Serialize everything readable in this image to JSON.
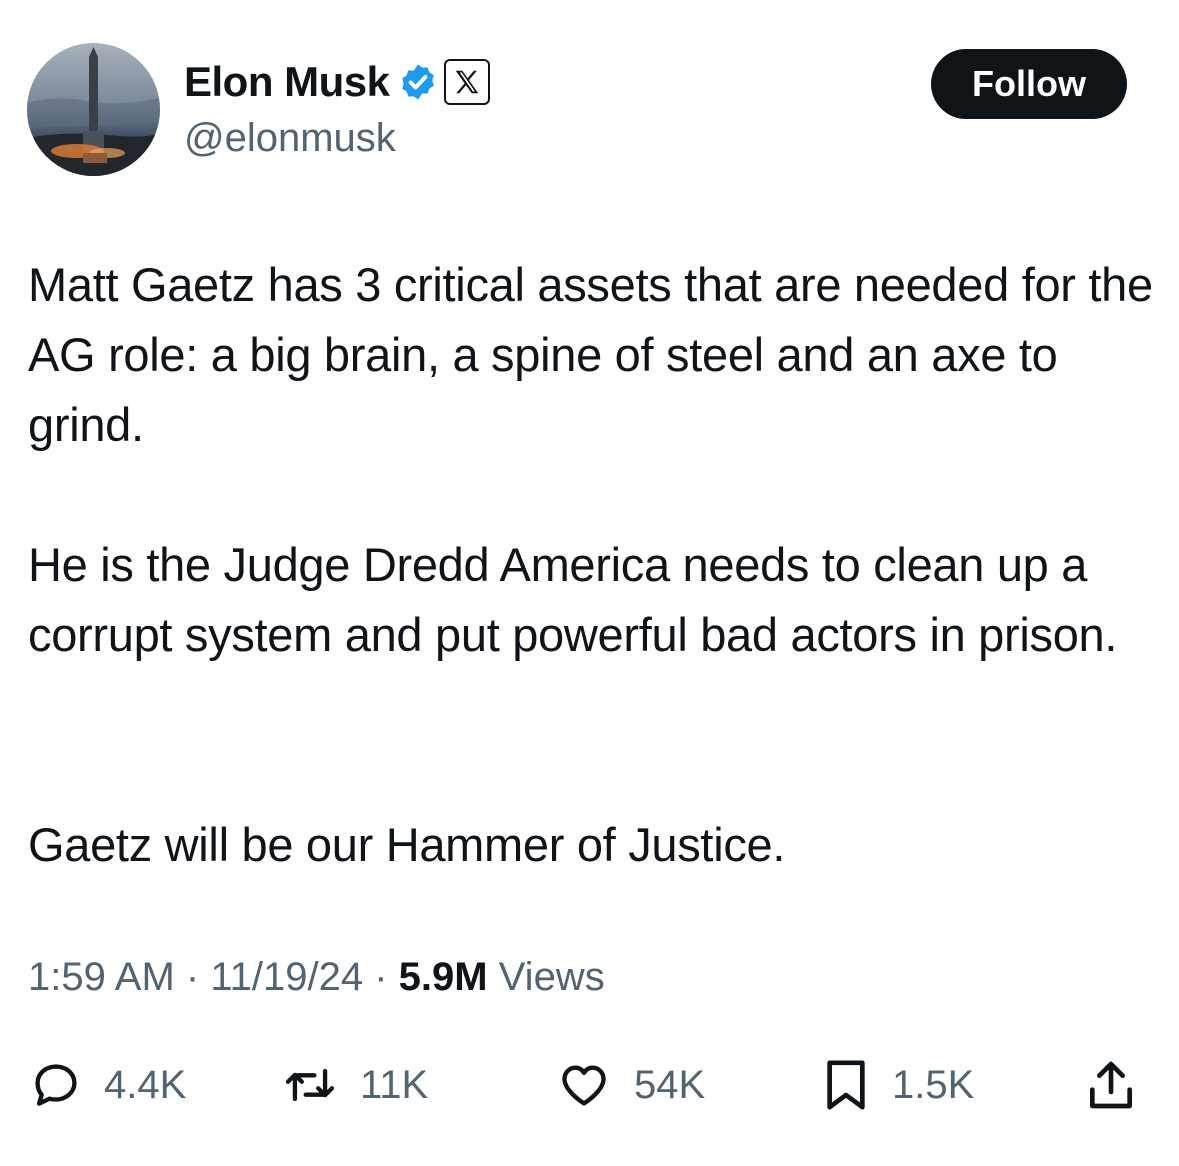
{
  "author": {
    "name": "Elon Musk",
    "handle": "@elonmusk"
  },
  "follow_label": "Follow",
  "tweet": {
    "paragraphs": [
      "Matt Gaetz has 3 critical assets that are needed for the AG role: a big brain, a spine of steel and an axe to grind.",
      "He is the Judge Dredd America needs to clean up a corrupt system and put powerful bad actors in prison.",
      "Gaetz will be our Hammer of Justice."
    ]
  },
  "meta": {
    "time": "1:59 AM",
    "separator": "·",
    "date": "11/19/24",
    "views_count": "5.9M",
    "views_label": "Views"
  },
  "actions": {
    "replies": "4.4K",
    "reposts": "11K",
    "likes": "54K",
    "bookmarks": "1.5K"
  },
  "icons": {
    "verified": "verified-badge-icon",
    "affiliate": "x-logo-icon",
    "reply": "reply-icon",
    "repost": "repost-icon",
    "like": "heart-icon",
    "bookmark": "bookmark-icon",
    "share": "share-icon"
  },
  "colors": {
    "text": "#0f1419",
    "secondary": "#536471",
    "verified": "#1d9bf0",
    "button_bg": "#0f1419",
    "button_text": "#ffffff"
  }
}
